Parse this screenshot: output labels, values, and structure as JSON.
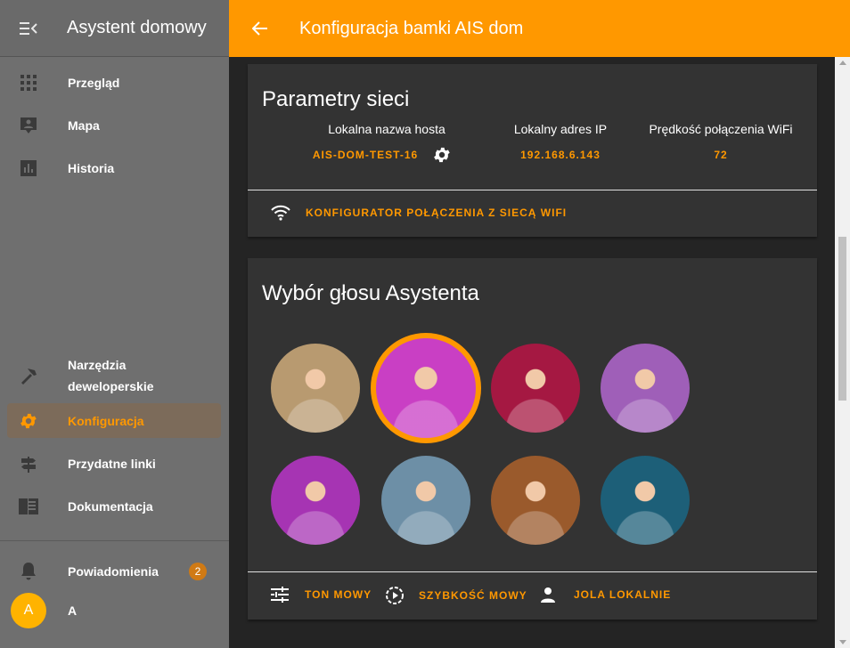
{
  "sidebar": {
    "title": "Asystent domowy",
    "items_top": [
      {
        "label": "Przegląd",
        "icon": "grid-icon"
      },
      {
        "label": "Mapa",
        "icon": "map-account-icon"
      },
      {
        "label": "Historia",
        "icon": "chart-bar-icon"
      }
    ],
    "items_bottom": [
      {
        "label": "Narzędzia deweloperskie",
        "icon": "hammer-icon"
      },
      {
        "label": "Konfiguracja",
        "icon": "gear-icon"
      },
      {
        "label": "Przydatne linki",
        "icon": "signpost-icon"
      },
      {
        "label": "Dokumentacja",
        "icon": "book-icon"
      }
    ],
    "notifications": {
      "label": "Powiadomienia",
      "count": "2"
    },
    "user": {
      "initial": "A",
      "name": "A"
    }
  },
  "topbar": {
    "title": "Konfiguracja bamki AIS dom"
  },
  "network": {
    "title": "Parametry sieci",
    "hostname_label": "Lokalna nazwa hosta",
    "hostname_value": "AIS-DOM-TEST-16",
    "ip_label": "Lokalny adres IP",
    "ip_value": "192.168.6.143",
    "wifi_speed_label": "Prędkość połączenia WiFi",
    "wifi_speed_value": "72",
    "wifi_action": "KONFIGURATOR POŁĄCZENIA Z SIECĄ WIFI"
  },
  "voice": {
    "title": "Wybór głosu Asystenta",
    "selected_index": 1,
    "avatars": [
      {
        "name": "voice-avatar-1",
        "bg": "#b89a70"
      },
      {
        "name": "voice-avatar-2",
        "bg": "#c93fc4"
      },
      {
        "name": "voice-avatar-3",
        "bg": "#a51842"
      },
      {
        "name": "voice-avatar-4",
        "bg": "#9f5fb8"
      },
      {
        "name": "voice-avatar-5",
        "bg": "#a634b3"
      },
      {
        "name": "voice-avatar-6",
        "bg": "#6d8fa6"
      },
      {
        "name": "voice-avatar-7",
        "bg": "#9a5a2c"
      },
      {
        "name": "voice-avatar-8",
        "bg": "#1d5f78"
      }
    ],
    "actions": [
      {
        "label": "TON MOWY",
        "icon": "tune-icon"
      },
      {
        "label": "SZYBKOŚĆ MOWY",
        "icon": "speed-icon"
      },
      {
        "label": "JOLA LOKALNIE",
        "icon": "person-icon"
      }
    ]
  },
  "colors": {
    "accent": "#ff9800",
    "sidebar": "#6f6f6f",
    "card": "#333333"
  }
}
